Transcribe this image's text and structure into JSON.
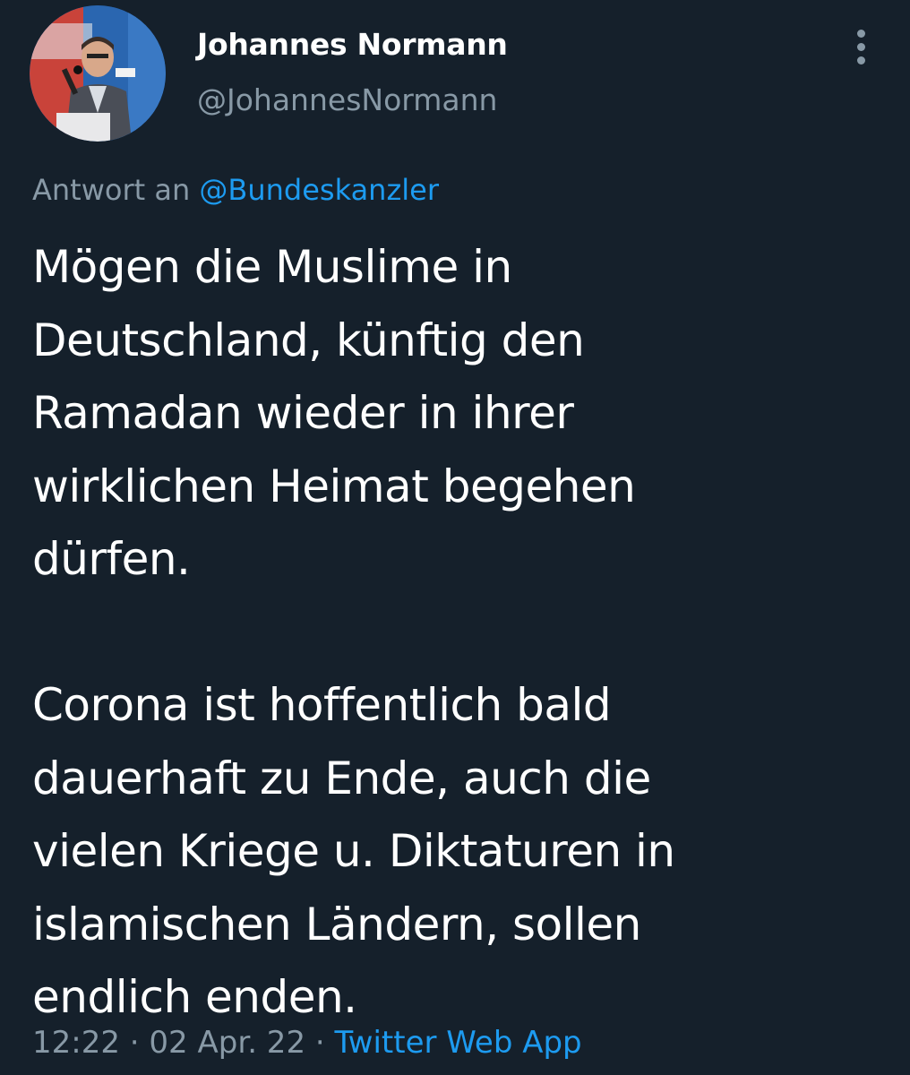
{
  "author": {
    "name": "Johannes Normann",
    "handle": "@JohannesNormann",
    "avatar_icon": "profile-photo"
  },
  "reply": {
    "prefix": "Antwort an ",
    "mention": "@Bundeskanzler"
  },
  "tweet": {
    "text": "Mögen die Muslime in\nDeutschland, künftig den\nRamadan wieder in ihrer\nwirklichen Heimat begehen\ndürfen.\n\nCorona ist hoffentlich bald\ndauerhaft zu Ende, auch die\nvielen Kriege u. Diktaturen in\nislamischen Ländern, sollen\nendlich enden."
  },
  "meta": {
    "time": "12:22",
    "separator": " · ",
    "date": "02 Apr. 22",
    "source": "Twitter Web App"
  },
  "menu": {
    "icon": "more-vertical-icon"
  },
  "colors": {
    "background": "#15202b",
    "text": "#ffffff",
    "secondary": "#8899a6",
    "link": "#1d9bf0"
  }
}
